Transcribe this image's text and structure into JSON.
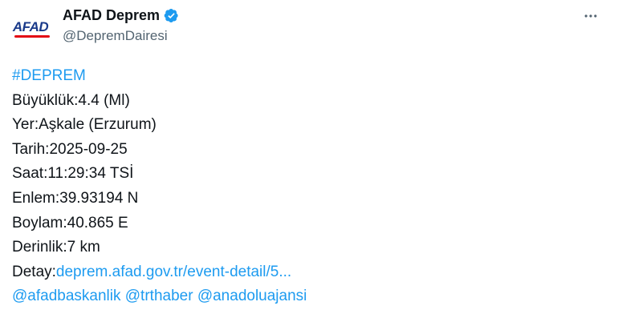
{
  "author": {
    "avatar_text": "AFAD",
    "display_name": "AFAD Deprem",
    "handle": "@DepremDairesi",
    "verified": true
  },
  "colors": {
    "link": "#1d9bf0",
    "verified_badge": "#1d9bf0",
    "text": "#0f1419",
    "secondary_text": "#536471",
    "logo_blue": "#1a3a8a",
    "logo_red": "#e30613"
  },
  "icons": {
    "more": "more-horizontal-icon",
    "verified": "verified-badge-icon"
  },
  "tweet": {
    "hashtag": "#DEPREM",
    "magnitude": "Büyüklük:4.4 (Ml)",
    "location": "Yer:Aşkale (Erzurum)",
    "date": "Tarih:2025-09-25",
    "time": "Saat:11:29:34 TSİ",
    "latitude": "Enlem:39.93194 N",
    "longitude": "Boylam:40.865 E",
    "depth": "Derinlik:7 km",
    "detail_label": "Detay:",
    "detail_link": "deprem.afad.gov.tr/event-detail/5...",
    "mentions": [
      "@afadbaskanlik",
      "@trthaber",
      "@anadoluajansi"
    ]
  }
}
